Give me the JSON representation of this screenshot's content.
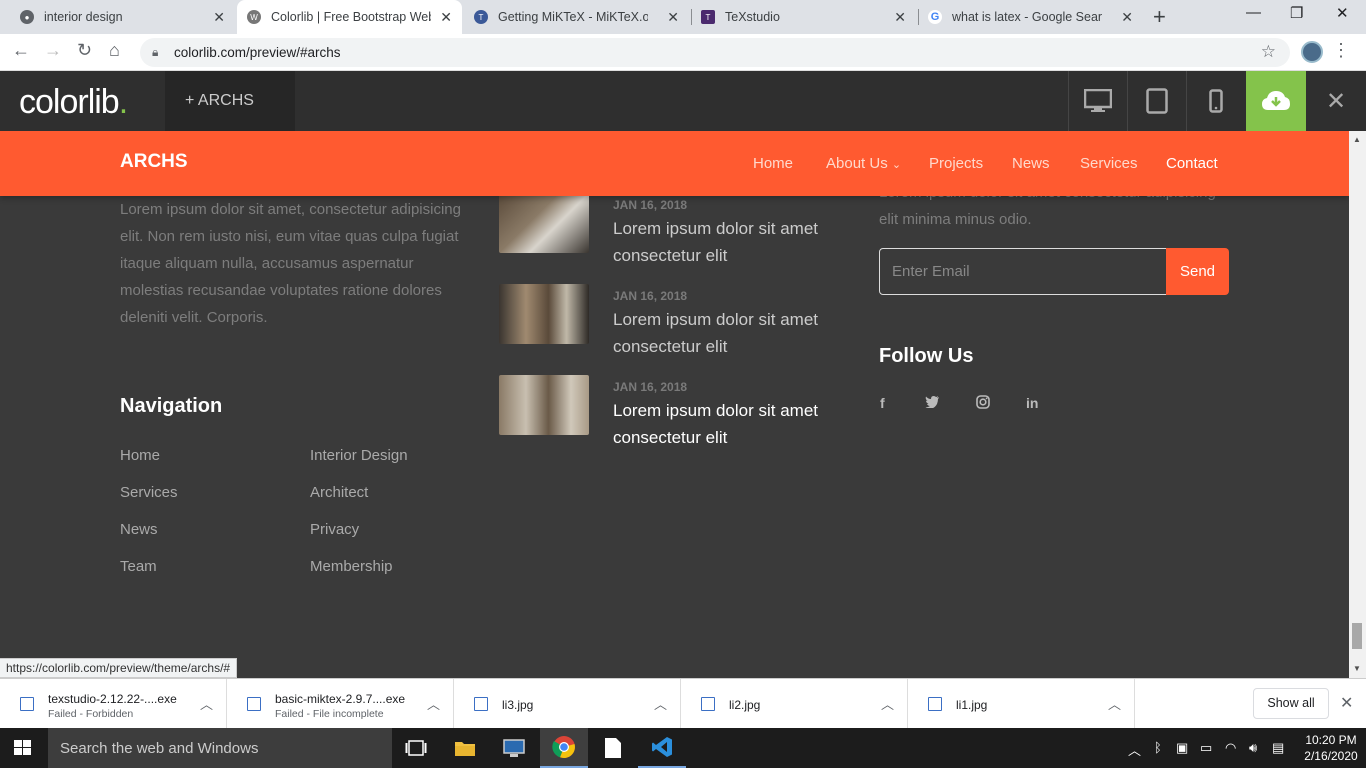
{
  "browser": {
    "tabs": [
      {
        "title": "interior design",
        "icon": "globe-icon"
      },
      {
        "title": "Colorlib | Free Bootstrap Webs",
        "icon": "wordpress-icon"
      },
      {
        "title": "Getting MiKTeX - MiKTeX.org",
        "icon": "tex-icon"
      },
      {
        "title": "TeXstudio",
        "icon": "texstudio-icon"
      },
      {
        "title": "what is latex - Google Search",
        "icon": "google-icon"
      }
    ],
    "url": "colorlib.com/preview/#archs"
  },
  "colorlib": {
    "logo": "colorlib",
    "logo_dot": ".",
    "theme_tab": "+  ARCHS"
  },
  "site": {
    "brand": "ARCHS",
    "menu": [
      "Home",
      "About Us",
      "Projects",
      "News",
      "Services",
      "Contact"
    ],
    "about_text": "Lorem ipsum dolor sit amet, consectetur adipisicing elit. Non rem iusto nisi, eum vitae quas culpa fugiat itaque aliquam nulla, accusamus aspernatur molestias recusandae voluptates ratione dolores deleniti velit. Corporis.",
    "nav_heading": "Navigation",
    "nav_col1": [
      "Home",
      "Services",
      "News",
      "Team"
    ],
    "nav_col2": [
      "Interior Design",
      "Architect",
      "Privacy",
      "Membership"
    ],
    "posts": [
      {
        "date": "JAN 16, 2018",
        "title": "Lorem ipsum dolor sit amet consectetur elit"
      },
      {
        "date": "JAN 16, 2018",
        "title": "Lorem ipsum dolor sit amet consectetur elit"
      },
      {
        "date": "JAN 16, 2018",
        "title": "Lorem ipsum dolor sit amet consectetur elit"
      }
    ],
    "newsletter_text": "Lorem ipsum dolor sit amet consectetur adipisicing elit minima minus odio.",
    "email_placeholder": "Enter Email",
    "send_label": "Send",
    "follow_heading": "Follow Us",
    "social": [
      "f",
      "t",
      "ig",
      "in"
    ]
  },
  "status_url": "https://colorlib.com/preview/theme/archs/#",
  "downloads": [
    {
      "name": "texstudio-2.12.22-....exe",
      "status": "Failed - Forbidden"
    },
    {
      "name": "basic-miktex-2.9.7....exe",
      "status": "Failed - File incomplete"
    },
    {
      "name": "li3.jpg",
      "status": ""
    },
    {
      "name": "li2.jpg",
      "status": ""
    },
    {
      "name": "li1.jpg",
      "status": ""
    }
  ],
  "show_all": "Show all",
  "taskbar": {
    "search": "Search the web and Windows",
    "time": "10:20 PM",
    "date": "2/16/2020"
  },
  "colors": {
    "accent": "#ff5a30",
    "colorlib_green": "#84c34b",
    "dark_bg": "#3a3a3a"
  }
}
